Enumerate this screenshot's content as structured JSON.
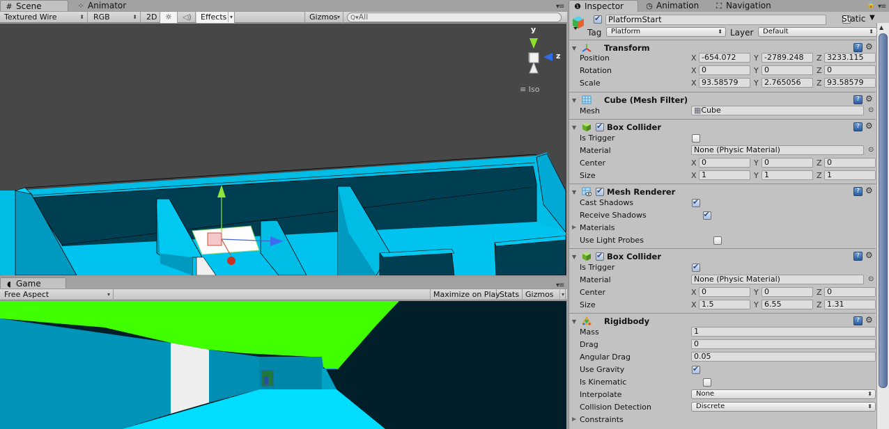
{
  "scene_panel": {
    "tabs": [
      {
        "label": "Scene",
        "icon": "grid-hash-icon",
        "active": true
      },
      {
        "label": "Animator",
        "icon": "animator-icon",
        "active": false
      }
    ],
    "toolbar": {
      "render_mode": "Textured Wire",
      "color_mode": "RGB",
      "toggle_2d": "2D",
      "lighting_icon": "sun-icon",
      "audio_icon": "speaker-icon",
      "effects": "Effects",
      "gizmos": "Gizmos",
      "search_placeholder": "All"
    },
    "orientation_gizmo": {
      "y_label": "y",
      "z_label": "z",
      "projection": "Iso"
    }
  },
  "game_panel": {
    "tab": {
      "label": "Game",
      "icon": "pacman-icon"
    },
    "toolbar": {
      "aspect": "Free Aspect",
      "maximize_on_play": "Maximize on Play",
      "stats": "Stats",
      "gizmos": "Gizmos"
    }
  },
  "inspector": {
    "tabs": [
      {
        "label": "Inspector",
        "icon": "info-icon",
        "active": true
      },
      {
        "label": "Animation",
        "icon": "clock-icon",
        "active": false
      },
      {
        "label": "Navigation",
        "icon": "navigation-icon",
        "active": false
      }
    ],
    "object": {
      "active": true,
      "name": "PlatformStart",
      "static_label": "Static",
      "static": false,
      "tag_label": "Tag",
      "tag": "Platform",
      "layer_label": "Layer",
      "layer": "Default"
    },
    "transform": {
      "title": "Transform",
      "rows": [
        {
          "label": "Position",
          "x": "-654.072",
          "y": "-2789.248",
          "z": "3233.115"
        },
        {
          "label": "Rotation",
          "x": "0",
          "y": "0",
          "z": "0"
        },
        {
          "label": "Scale",
          "x": "93.58579",
          "y": "2.765056",
          "z": "93.58579"
        }
      ]
    },
    "mesh_filter": {
      "title": "Cube (Mesh Filter)",
      "mesh_label": "Mesh",
      "mesh": "Cube"
    },
    "box_collider_1": {
      "title": "Box Collider",
      "enabled": true,
      "is_trigger_label": "Is Trigger",
      "is_trigger": false,
      "material_label": "Material",
      "material": "None (Physic Material)",
      "center": {
        "label": "Center",
        "x": "0",
        "y": "0",
        "z": "0"
      },
      "size": {
        "label": "Size",
        "x": "1",
        "y": "1",
        "z": "1"
      }
    },
    "mesh_renderer": {
      "title": "Mesh Renderer",
      "enabled": true,
      "cast_shadows_label": "Cast Shadows",
      "cast_shadows": true,
      "receive_shadows_label": "Receive Shadows",
      "receive_shadows": true,
      "materials_label": "Materials",
      "use_light_probes_label": "Use Light Probes",
      "use_light_probes": false
    },
    "box_collider_2": {
      "title": "Box Collider",
      "enabled": true,
      "is_trigger_label": "Is Trigger",
      "is_trigger": true,
      "material_label": "Material",
      "material": "None (Physic Material)",
      "center": {
        "label": "Center",
        "x": "0",
        "y": "0",
        "z": "0"
      },
      "size": {
        "label": "Size",
        "x": "1.5",
        "y": "6.55",
        "z": "1.31"
      }
    },
    "rigidbody": {
      "title": "Rigidbody",
      "mass_label": "Mass",
      "mass": "1",
      "drag_label": "Drag",
      "drag": "0",
      "angular_drag_label": "Angular Drag",
      "angular_drag": "0.05",
      "use_gravity_label": "Use Gravity",
      "use_gravity": true,
      "is_kinematic_label": "Is Kinematic",
      "is_kinematic": false,
      "interpolate_label": "Interpolate",
      "interpolate": "None",
      "collision_detection_label": "Collision Detection",
      "collision_detection": "Discrete",
      "constraints_label": "Constraints"
    },
    "axis_labels": {
      "x": "X",
      "y": "Y",
      "z": "Z"
    },
    "help_glyph": "?",
    "gear_glyph": "⚙"
  },
  "colors": {
    "scene_background": "#474747",
    "level_cyan": "#00c8f0",
    "level_dark": "#003e50",
    "game_sky_green": "#40ff00",
    "game_void": "#011f28"
  }
}
